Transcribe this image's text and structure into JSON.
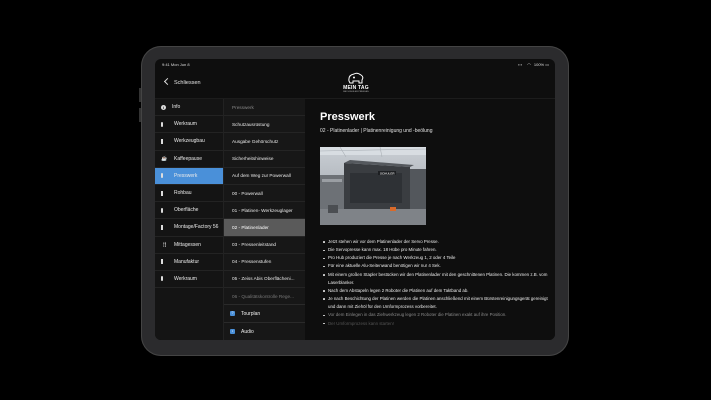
{
  "status": {
    "time": "9:41  Mon Jun 8",
    "battery": "100%"
  },
  "header": {
    "back_label": "Schliessen",
    "logo_title": "MEIN TAG",
    "logo_subtitle": "BEI SCHULER PRESSES"
  },
  "menu": [
    {
      "label": "Info",
      "icon": "info-icon"
    },
    {
      "label": "Werkraum",
      "icon": "monitor-icon"
    },
    {
      "label": "Werkzeugbau",
      "icon": "box-icon"
    },
    {
      "label": "Kaffeepause",
      "icon": "coffee-icon"
    },
    {
      "label": "Presswerk",
      "icon": "monitor-icon",
      "active": true
    },
    {
      "label": "Rohbau",
      "icon": "box-icon"
    },
    {
      "label": "Oberfläche",
      "icon": "monitor-icon"
    },
    {
      "label": "Montage/Factory 56",
      "icon": "box-icon"
    },
    {
      "label": "Mittagessen",
      "icon": "cutlery-icon"
    },
    {
      "label": "Manufaktur",
      "icon": "box-icon"
    },
    {
      "label": "Werkraum",
      "icon": "monitor-icon"
    }
  ],
  "submenu": {
    "heading": "Presswerk",
    "items": [
      "Schutzausrüstung",
      "Ausgabe Gehörschutz",
      "Sicherheitshinweise",
      "Auf dem Weg zur Powerwall",
      "00 - Powerwall",
      "01 - Platinen- Werkzeuglager",
      "02 - Platinenlader",
      "03 - Pressenleitstand",
      "04 - Pressenstufen",
      "05 - Zeiss Abis Oberflächeni...",
      "06 - Qualitätskontrolle Rege..."
    ],
    "links": [
      {
        "label": "Tourplan"
      },
      {
        "label": "Audio"
      }
    ]
  },
  "content": {
    "title": "Presswerk",
    "subtitle": "02 - Platinenlader | Platinenreinigung und -beölung",
    "photo_sign": "SCHULER",
    "bullets": [
      "Jetzt stehen wir vor dem Platinenlader der Servo Presse.",
      "Die Servopresse kann max. 18 Hübe pro Minute fahren.",
      "Pro Hub produziert die Presse je nach Werkzeug 1, 2 oder 4 Teile",
      "Für eine aktuelle Alu-Seitenwand benötigen wir nur 4 Sek.",
      "Mit einem großen Stapler bestücken wir den Platinenlader mit den geschnittenen Platinen. Die kommen z.B. vom Laserblanker.",
      "Nach dem Abstapeln legen 2 Roboter die Platinen auf dem Taktband ab.",
      "Je nach Beschichtung der Platinen werden die Platinen anschließend mit einem Bürstenreinigungsgerät gereinigt und dann mit Ziehöl für den Umformprozess vorbereitet.",
      "Vor dem Einlegen in das Ziehwerkzeug legen 2 Roboter die Platinen exakt auf ihre Position.",
      "Der Umformprozess kann starten!"
    ]
  }
}
